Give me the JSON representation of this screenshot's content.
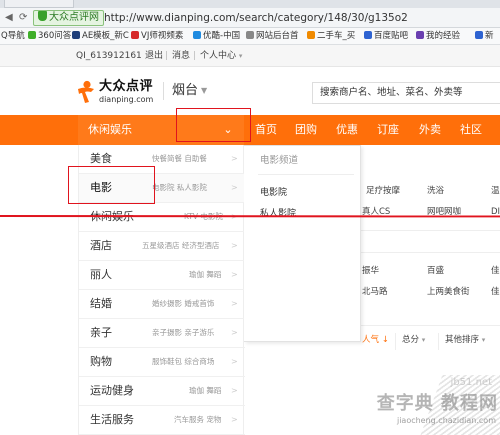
{
  "browser": {
    "tab_title": "",
    "secure_label": "大众点评网",
    "url": "http://www.dianping.com/search/category/148/30/g135o2",
    "bookmarks": [
      {
        "label": "Q导航",
        "color": "#2b6ad6"
      },
      {
        "label": "360问答",
        "color": "#3fae29"
      },
      {
        "label": "AE模板_新C",
        "color": "#1f3f7a"
      },
      {
        "label": "VJ师视频素",
        "color": "#d62a2a"
      },
      {
        "label": "优酷-中国",
        "color": "#1f8be0"
      },
      {
        "label": "网站后台首",
        "color": "#888888"
      },
      {
        "label": "二手车_买",
        "color": "#f08a00"
      },
      {
        "label": "百度贴吧",
        "color": "#2e63d1"
      },
      {
        "label": "我的经验",
        "color": "#6a3fb0"
      },
      {
        "label": "新",
        "color": "#2e63d1"
      }
    ]
  },
  "topbar": {
    "user": "QI_613912161",
    "logout": "退出",
    "messages": "消息",
    "personal_center": "个人中心"
  },
  "header": {
    "logo_cn": "大众点评",
    "logo_en": "dianping.com",
    "city": "烟台",
    "search_placeholder": "搜索商户名、地址、菜名、外卖等"
  },
  "nav": {
    "current_category": "休闲娱乐",
    "items": [
      "首页",
      "团购",
      "优惠",
      "订座",
      "外卖",
      "社区"
    ]
  },
  "menu": [
    {
      "name": "美食",
      "sub": "快餐简餐 自助餐"
    },
    {
      "name": "电影",
      "sub": "电影院 私人影院"
    },
    {
      "name": "休闲娱乐",
      "sub": "KTV 电影院"
    },
    {
      "name": "酒店",
      "sub": "五星级酒店 经济型酒店"
    },
    {
      "name": "丽人",
      "sub": "瑜伽 舞蹈"
    },
    {
      "name": "结婚",
      "sub": "婚纱摄影 婚戒首饰"
    },
    {
      "name": "亲子",
      "sub": "亲子摄影 亲子游乐"
    },
    {
      "name": "购物",
      "sub": "服饰鞋包 综合商场"
    },
    {
      "name": "运动健身",
      "sub": "瑜伽 舞蹈"
    },
    {
      "name": "生活服务",
      "sub": "汽车服务 宠物"
    }
  ],
  "submenu": {
    "title": "电影频道",
    "links": [
      "电影院",
      "私人影院"
    ]
  },
  "content": {
    "row1": [
      "足疗按摩",
      "洗浴",
      "温"
    ],
    "row2": [
      "真人CS",
      "网吧网咖",
      "DI"
    ],
    "row3": [
      "振华",
      "百盛",
      "佳"
    ],
    "row4": [
      "北马路",
      "上两美食街",
      "佳"
    ],
    "filters": [
      "人气",
      "总分",
      "其他排序"
    ]
  },
  "watermark": {
    "site": "jb51.net",
    "brand": "查字典 教程网",
    "url": "jiaocheng.chazidian.com"
  },
  "colors": {
    "accent": "#ff6f0a",
    "annotation": "#e0141e"
  }
}
